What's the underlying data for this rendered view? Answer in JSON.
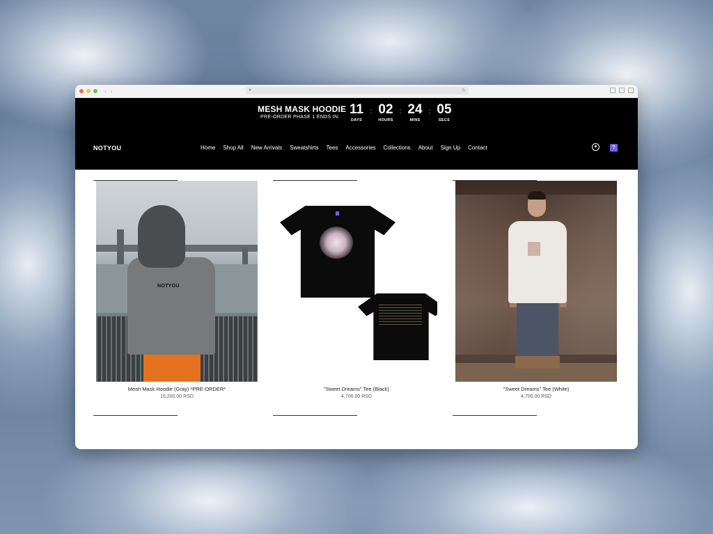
{
  "browser": {
    "traffic_lights": [
      "close",
      "minimize",
      "zoom"
    ]
  },
  "promo": {
    "title": "MESH MASK HOODIE",
    "subtitle": "PRE-ORDER PHASE 1 ENDS IN:",
    "countdown": [
      {
        "value": "11",
        "label": "DAYS"
      },
      {
        "value": "02",
        "label": "HOURS"
      },
      {
        "value": "24",
        "label": "MINS"
      },
      {
        "value": "05",
        "label": "SECS"
      }
    ],
    "separator": ":"
  },
  "header": {
    "logo": "NOTYOU",
    "nav": [
      "Home",
      "Shop All",
      "New Arrivals",
      "Sweatshirts",
      "Tees",
      "Accessories",
      "Collections",
      "About",
      "Sign Up",
      "Contact"
    ],
    "cart_badge": "?",
    "icons": [
      "user-icon",
      "shopping-bag-icon"
    ],
    "accent_color": "#7b5be0"
  },
  "products": [
    {
      "name": "Mesh Mask Hoodie (Gray) *PRE-ORDER*",
      "price": "15,200.00 RSD",
      "print": "NOTYOU"
    },
    {
      "name": "\"Sweet Dreams\" Tee (Black)",
      "price": "4,700.00 RSD"
    },
    {
      "name": "\"Sweet Dreams\" Tee (White)",
      "price": "4,700.00 RSD"
    }
  ]
}
